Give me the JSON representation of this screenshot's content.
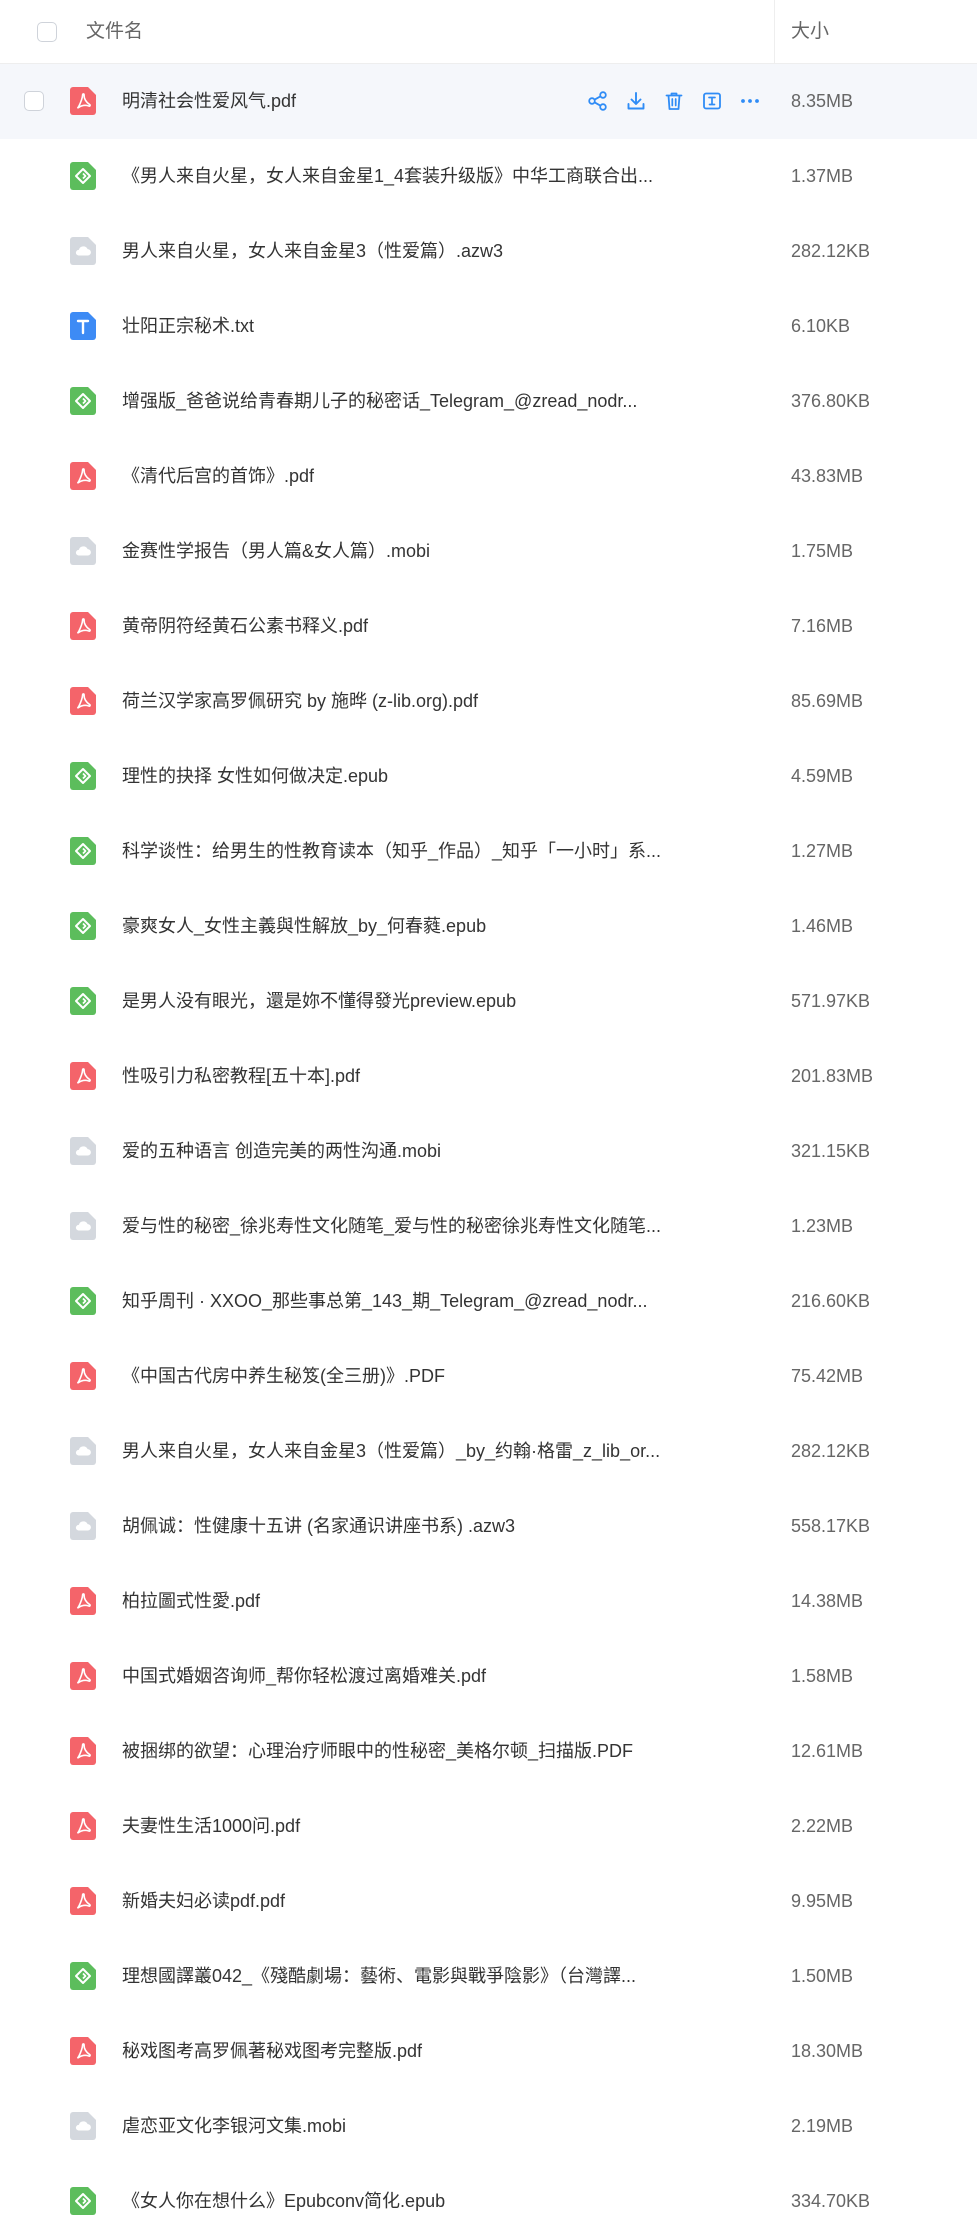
{
  "header": {
    "name_label": "文件名",
    "size_label": "大小"
  },
  "colors": {
    "pdf": "#f4646a",
    "epub": "#5cbd5c",
    "txt": "#3d8bf5",
    "other": "#d4d8de",
    "action": "#2f8cf6"
  },
  "actions": [
    {
      "name": "share-icon"
    },
    {
      "name": "download-icon"
    },
    {
      "name": "delete-icon"
    },
    {
      "name": "rename-icon"
    },
    {
      "name": "more-icon"
    }
  ],
  "files": [
    {
      "name": "明清社会性爱风气.pdf",
      "size": "8.35MB",
      "type": "pdf"
    },
    {
      "name": "《男人来自火星，女人来自金星1_4套装升级版》中华工商联合出...",
      "size": "1.37MB",
      "type": "epub"
    },
    {
      "name": "男人来自火星，女人来自金星3（性爱篇）.azw3",
      "size": "282.12KB",
      "type": "other"
    },
    {
      "name": "壮阳正宗秘术.txt",
      "size": "6.10KB",
      "type": "txt"
    },
    {
      "name": "增强版_爸爸说给青春期儿子的秘密话_Telegram_@zread_nodr...",
      "size": "376.80KB",
      "type": "epub"
    },
    {
      "name": "《清代后宫的首饰》.pdf",
      "size": "43.83MB",
      "type": "pdf"
    },
    {
      "name": "金赛性学报告（男人篇&女人篇）.mobi",
      "size": "1.75MB",
      "type": "other"
    },
    {
      "name": "黄帝阴符经黄石公素书释义.pdf",
      "size": "7.16MB",
      "type": "pdf"
    },
    {
      "name": "荷兰汉学家高罗佩研究 by 施晔 (z-lib.org).pdf",
      "size": "85.69MB",
      "type": "pdf"
    },
    {
      "name": "理性的抉择 女性如何做决定.epub",
      "size": "4.59MB",
      "type": "epub"
    },
    {
      "name": "科学谈性：给男生的性教育读本（知乎_作品）_知乎「一小时」系...",
      "size": "1.27MB",
      "type": "epub"
    },
    {
      "name": "豪爽女人_女性主義與性解放_by_何春蕤.epub",
      "size": "1.46MB",
      "type": "epub"
    },
    {
      "name": "是男人没有眼光，還是妳不懂得發光preview.epub",
      "size": "571.97KB",
      "type": "epub"
    },
    {
      "name": "性吸引力私密教程[五十本].pdf",
      "size": "201.83MB",
      "type": "pdf"
    },
    {
      "name": "爱的五种语言 创造完美的两性沟通.mobi",
      "size": "321.15KB",
      "type": "other"
    },
    {
      "name": "爱与性的秘密_徐兆寿性文化随笔_爱与性的秘密徐兆寿性文化随笔...",
      "size": "1.23MB",
      "type": "other"
    },
    {
      "name": "知乎周刊 · XXOO_那些事总第_143_期_Telegram_@zread_nodr...",
      "size": "216.60KB",
      "type": "epub"
    },
    {
      "name": "《中国古代房中养生秘笈(全三册)》.PDF",
      "size": "75.42MB",
      "type": "pdf"
    },
    {
      "name": "男人来自火星，女人来自金星3（性爱篇）_by_约翰·格雷_z_lib_or...",
      "size": "282.12KB",
      "type": "other"
    },
    {
      "name": "胡佩诚：性健康十五讲 (名家通识讲座书系) .azw3",
      "size": "558.17KB",
      "type": "other"
    },
    {
      "name": "柏拉圖式性愛.pdf",
      "size": "14.38MB",
      "type": "pdf"
    },
    {
      "name": "中国式婚姻咨询师_帮你轻松渡过离婚难关.pdf",
      "size": "1.58MB",
      "type": "pdf"
    },
    {
      "name": "被捆绑的欲望：心理治疗师眼中的性秘密_美格尔顿_扫描版.PDF",
      "size": "12.61MB",
      "type": "pdf"
    },
    {
      "name": "夫妻性生活1000问.pdf",
      "size": "2.22MB",
      "type": "pdf"
    },
    {
      "name": "新婚夫妇必读pdf.pdf",
      "size": "9.95MB",
      "type": "pdf"
    },
    {
      "name": "理想國譯叢042_《殘酷劇場：藝術、電影與戰爭陰影》（台灣譯...",
      "size": "1.50MB",
      "type": "epub"
    },
    {
      "name": "秘戏图考高罗佩著秘戏图考完整版.pdf",
      "size": "18.30MB",
      "type": "pdf"
    },
    {
      "name": "虐恋亚文化李银河文集.mobi",
      "size": "2.19MB",
      "type": "other"
    },
    {
      "name": "《女人你在想什么》Epubconv简化.epub",
      "size": "334.70KB",
      "type": "epub"
    }
  ]
}
